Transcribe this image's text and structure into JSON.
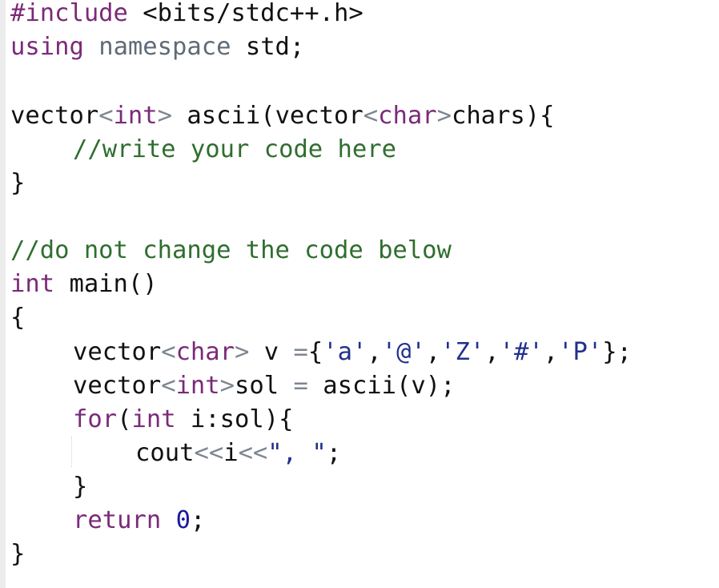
{
  "editor": {
    "language": "C++",
    "lines": [
      {
        "indent": 0,
        "tokens": [
          {
            "t": "#include",
            "c": "kw"
          },
          {
            "t": " <bits/stdc++.h>",
            "c": "pl"
          }
        ]
      },
      {
        "indent": 0,
        "tokens": [
          {
            "t": "using",
            "c": "kw"
          },
          {
            "t": " ",
            "c": "pl"
          },
          {
            "t": "namespace",
            "c": "ns"
          },
          {
            "t": " std;",
            "c": "pl"
          }
        ]
      },
      {
        "indent": 0,
        "tokens": []
      },
      {
        "indent": 0,
        "tokens": [
          {
            "t": "vector",
            "c": "pl"
          },
          {
            "t": "<",
            "c": "op"
          },
          {
            "t": "int",
            "c": "ty"
          },
          {
            "t": ">",
            "c": "op"
          },
          {
            "t": " ascii(vector",
            "c": "pl"
          },
          {
            "t": "<",
            "c": "op"
          },
          {
            "t": "char",
            "c": "ty"
          },
          {
            "t": ">",
            "c": "op"
          },
          {
            "t": "chars){",
            "c": "pl"
          }
        ]
      },
      {
        "indent": 1,
        "tokens": [
          {
            "t": "//write your code here",
            "c": "cm"
          }
        ]
      },
      {
        "indent": 0,
        "tokens": [
          {
            "t": "}",
            "c": "pl"
          }
        ]
      },
      {
        "indent": 0,
        "tokens": []
      },
      {
        "indent": 0,
        "tokens": [
          {
            "t": "//do not change the code below",
            "c": "cm"
          }
        ]
      },
      {
        "indent": 0,
        "tokens": [
          {
            "t": "int",
            "c": "ty"
          },
          {
            "t": " main()",
            "c": "pl"
          }
        ]
      },
      {
        "indent": 0,
        "tokens": [
          {
            "t": "{",
            "c": "pl"
          }
        ]
      },
      {
        "indent": 1,
        "tokens": [
          {
            "t": "vector",
            "c": "pl"
          },
          {
            "t": "<",
            "c": "op"
          },
          {
            "t": "char",
            "c": "ty"
          },
          {
            "t": ">",
            "c": "op"
          },
          {
            "t": " v ",
            "c": "pl"
          },
          {
            "t": "=",
            "c": "op"
          },
          {
            "t": "{",
            "c": "pl"
          },
          {
            "t": "'a'",
            "c": "str"
          },
          {
            "t": ",",
            "c": "pl"
          },
          {
            "t": "'@'",
            "c": "str"
          },
          {
            "t": ",",
            "c": "pl"
          },
          {
            "t": "'Z'",
            "c": "str"
          },
          {
            "t": ",",
            "c": "pl"
          },
          {
            "t": "'#'",
            "c": "str"
          },
          {
            "t": ",",
            "c": "pl"
          },
          {
            "t": "'P'",
            "c": "str"
          },
          {
            "t": "};",
            "c": "pl"
          }
        ]
      },
      {
        "indent": 1,
        "tokens": [
          {
            "t": "vector",
            "c": "pl"
          },
          {
            "t": "<",
            "c": "op"
          },
          {
            "t": "int",
            "c": "ty"
          },
          {
            "t": ">",
            "c": "op"
          },
          {
            "t": "sol ",
            "c": "pl"
          },
          {
            "t": "=",
            "c": "op"
          },
          {
            "t": " ascii(v);",
            "c": "pl"
          }
        ]
      },
      {
        "indent": 1,
        "tokens": [
          {
            "t": "for",
            "c": "kw"
          },
          {
            "t": "(",
            "c": "pl"
          },
          {
            "t": "int",
            "c": "ty"
          },
          {
            "t": " i:sol){",
            "c": "pl"
          }
        ]
      },
      {
        "indent": 2,
        "tokens": [
          {
            "t": "cout",
            "c": "pl"
          },
          {
            "t": "<<",
            "c": "op"
          },
          {
            "t": "i",
            "c": "pl"
          },
          {
            "t": "<<",
            "c": "op"
          },
          {
            "t": "\", \"",
            "c": "str"
          },
          {
            "t": ";",
            "c": "pl"
          }
        ]
      },
      {
        "indent": 1,
        "tokens": [
          {
            "t": "}",
            "c": "pl"
          }
        ]
      },
      {
        "indent": 1,
        "tokens": [
          {
            "t": "return",
            "c": "kw"
          },
          {
            "t": " ",
            "c": "pl"
          },
          {
            "t": "0",
            "c": "num"
          },
          {
            "t": ";",
            "c": "pl"
          }
        ]
      },
      {
        "indent": 0,
        "tokens": [
          {
            "t": "}",
            "c": "pl"
          }
        ]
      }
    ]
  }
}
